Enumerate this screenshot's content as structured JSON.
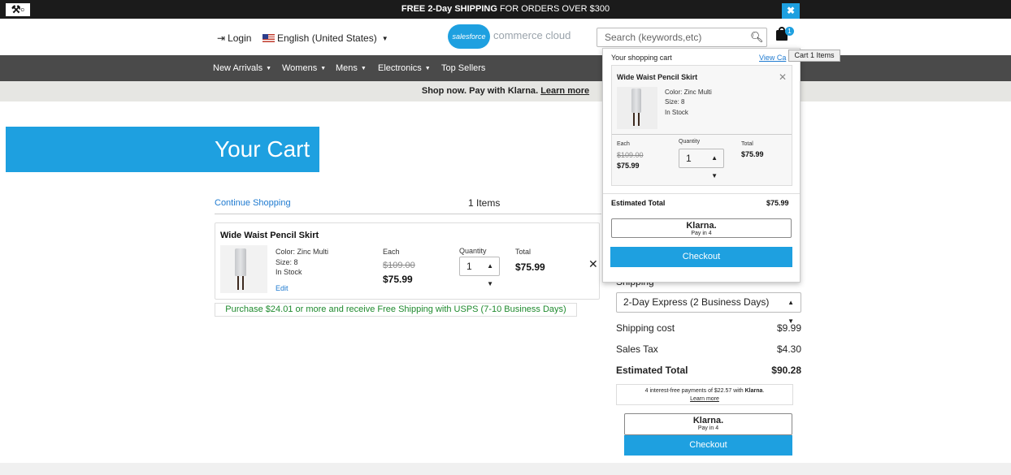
{
  "promo": {
    "bold": "FREE 2-Day SHIPPING",
    "rest": " FOR ORDERS OVER $300",
    "close": "✖"
  },
  "header": {
    "login": "Login",
    "language": "English (United States)",
    "logo_badge": "salesforce",
    "logo_text": "commerce cloud",
    "search_placeholder": "Search (keywords,etc)",
    "cart_count": "1",
    "cart_tooltip": "Cart 1 Items"
  },
  "nav": {
    "items": [
      "New Arrivals",
      "Womens",
      "Mens",
      "Electronics",
      "Top Sellers"
    ]
  },
  "klarna_strip": {
    "text": "Shop now. Pay with ",
    "brand": "Klarna",
    "after": ". ",
    "link": "Learn more"
  },
  "page": {
    "title": "Your Cart",
    "continue": "Continue Shopping",
    "item_count": "1 Items"
  },
  "line_item": {
    "name": "Wide Waist Pencil Skirt",
    "color": "Color: Zinc Multi",
    "size": "Size: 8",
    "stock": "In Stock",
    "edit": "Edit",
    "each_label": "Each",
    "list_price": "$109.00",
    "sale_price": "$75.99",
    "qty_label": "Quantity",
    "qty": "1",
    "total_label": "Total",
    "total": "$75.99",
    "remove": "✕"
  },
  "ship_note": "Purchase $24.01 or more and receive Free Shipping with USPS (7-10 Business Days)",
  "summary": {
    "shipping_label": "Shipping",
    "shipping_method": "2-Day Express (2 Business Days)",
    "shipping_cost_label": "Shipping cost",
    "shipping_cost": "$9.99",
    "tax_label": "Sales Tax",
    "tax": "$4.30",
    "total_label": "Estimated Total",
    "total": "$90.28",
    "klarna_msg_a": "4 interest-free payments of $22.57 with ",
    "klarna_msg_brand": "Klarna",
    "klarna_msg_link": "Learn more",
    "klarna_logo": "Klarna.",
    "klarna_pay": "Pay in 4",
    "checkout": "Checkout"
  },
  "mini_cart": {
    "header": "Your shopping cart",
    "view": "View Ca",
    "name": "Wide Waist Pencil Skirt",
    "color": "Color: Zinc Multi",
    "size": "Size: 8",
    "stock": "In Stock",
    "each_label": "Each",
    "list_price": "$109.00",
    "sale_price": "$75.99",
    "qty_label": "Quantity",
    "qty": "1",
    "total_label": "Total",
    "total": "$75.99",
    "remove": "✕",
    "est_label": "Estimated Total",
    "est_total": "$75.99",
    "klarna_logo": "Klarna.",
    "klarna_pay": "Pay in 4",
    "checkout": "Checkout"
  },
  "colors": {
    "accent": "#1ea0e0",
    "nav_bg": "#4a4a4a",
    "promo_bg": "#1b1b1b",
    "link": "#1e7ad0",
    "ship_note": "#1f8a2e"
  },
  "icons": [
    "tools-icon",
    "close-icon",
    "login-icon",
    "flag-icon",
    "search-icon",
    "cart-icon"
  ]
}
